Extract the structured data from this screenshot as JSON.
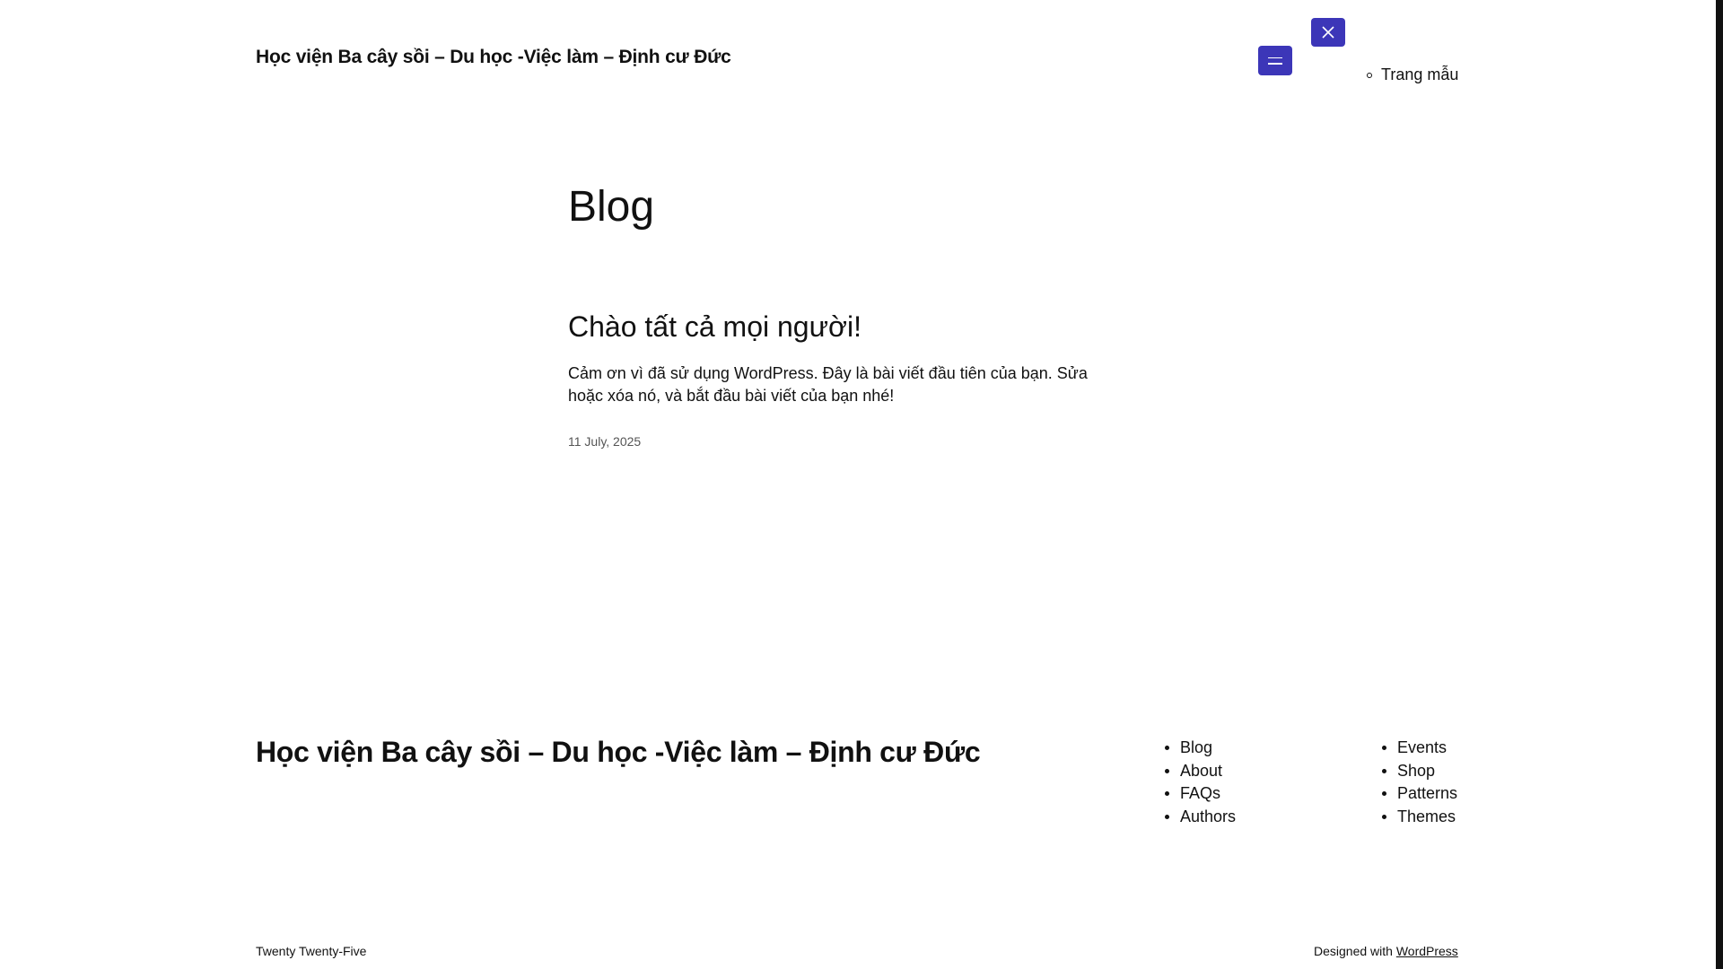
{
  "header": {
    "site_title": "Học viện Ba cây sồi – Du học -Việc làm – Định cư Đức",
    "menu_icon": "hamburger-icon",
    "close_icon": "close-icon",
    "overlay_menu_items": [
      "Trang mẫu"
    ]
  },
  "main": {
    "heading": "Blog",
    "posts": [
      {
        "title": "Chào tất cả mọi người!",
        "excerpt": "Cảm ơn vì đã sử dụng WordPress. Đây là bài viết đầu tiên của bạn. Sửa hoặc xóa nó, và bắt đầu bài viết của bạn nhé!",
        "date": "11 July, 2025"
      }
    ]
  },
  "footer": {
    "site_title": "Học viện Ba cây sồi – Du học -Việc làm – Định cư Đức",
    "nav_col1": [
      "Blog",
      "About",
      "FAQs",
      "Authors"
    ],
    "nav_col2": [
      "Events",
      "Shop",
      "Patterns",
      "Themes"
    ],
    "theme_credit": "Twenty Twenty-Five",
    "designed_with": "Designed with",
    "designed_link": "WordPress"
  },
  "colors": {
    "accent": "#3c36b8",
    "text": "#111111",
    "muted": "#555555",
    "background": "#ffffff"
  }
}
